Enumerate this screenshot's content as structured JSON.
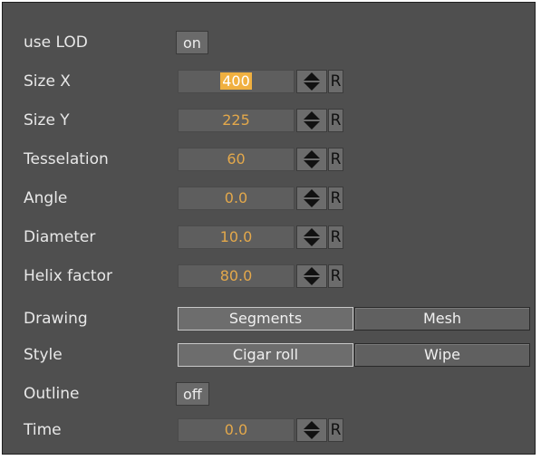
{
  "use_lod": {
    "label": "use LOD",
    "value": "on"
  },
  "fields": [
    {
      "label": "Size X",
      "value": "400"
    },
    {
      "label": "Size Y",
      "value": "225"
    },
    {
      "label": "Tesselation",
      "value": "60"
    },
    {
      "label": "Angle",
      "value": "0.0"
    },
    {
      "label": "Diameter",
      "value": "10.0"
    },
    {
      "label": "Helix factor",
      "value": "80.0"
    }
  ],
  "reset_label": "R",
  "drawing": {
    "label": "Drawing",
    "options": [
      "Segments",
      "Mesh"
    ],
    "selected": "Segments"
  },
  "style": {
    "label": "Style",
    "options": [
      "Cigar roll",
      "Wipe"
    ],
    "selected": "Cigar roll"
  },
  "outline": {
    "label": "Outline",
    "value": "off"
  },
  "time": {
    "label": "Time",
    "value": "0.0"
  },
  "colors": {
    "panel_bg": "#4f4f4f",
    "value_text": "#e3a84b",
    "selection": "#f0b040"
  },
  "icons": {
    "spinner": "up-down-arrow-icon"
  }
}
